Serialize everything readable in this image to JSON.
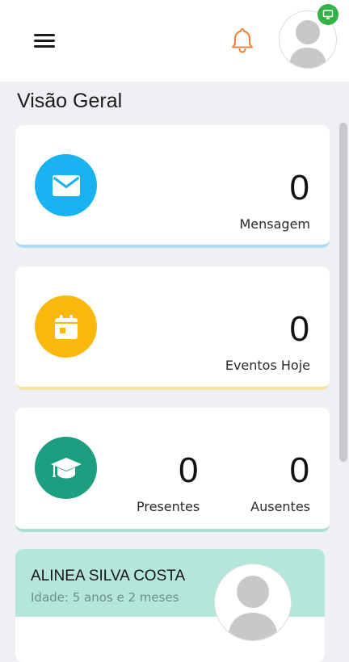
{
  "header": {
    "menu_icon": "hamburger-menu-icon",
    "notification_icon": "bell-icon",
    "notification_color": "#e8823e",
    "avatar_icon": "user-avatar-icon",
    "status_icon": "monitor-icon",
    "status_color": "#33b249"
  },
  "overview": {
    "title": "Visão Geral"
  },
  "cards": {
    "messages": {
      "icon": "envelope-icon",
      "color": "#1ab2f0",
      "count": "0",
      "label": "Mensagem"
    },
    "events": {
      "icon": "calendar-icon",
      "color": "#fab80c",
      "count": "0",
      "label": "Eventos Hoje"
    },
    "attendance": {
      "icon": "graduation-cap-icon",
      "color": "#1c9e81",
      "present_count": "0",
      "present_label": "Presentes",
      "absent_count": "0",
      "absent_label": "Ausentes"
    }
  },
  "student": {
    "name": "ALINEA SILVA COSTA",
    "age": "Idade: 5 anos e 2 meses",
    "header_color": "#b5e6dc",
    "photo_icon": "user-avatar-icon"
  }
}
